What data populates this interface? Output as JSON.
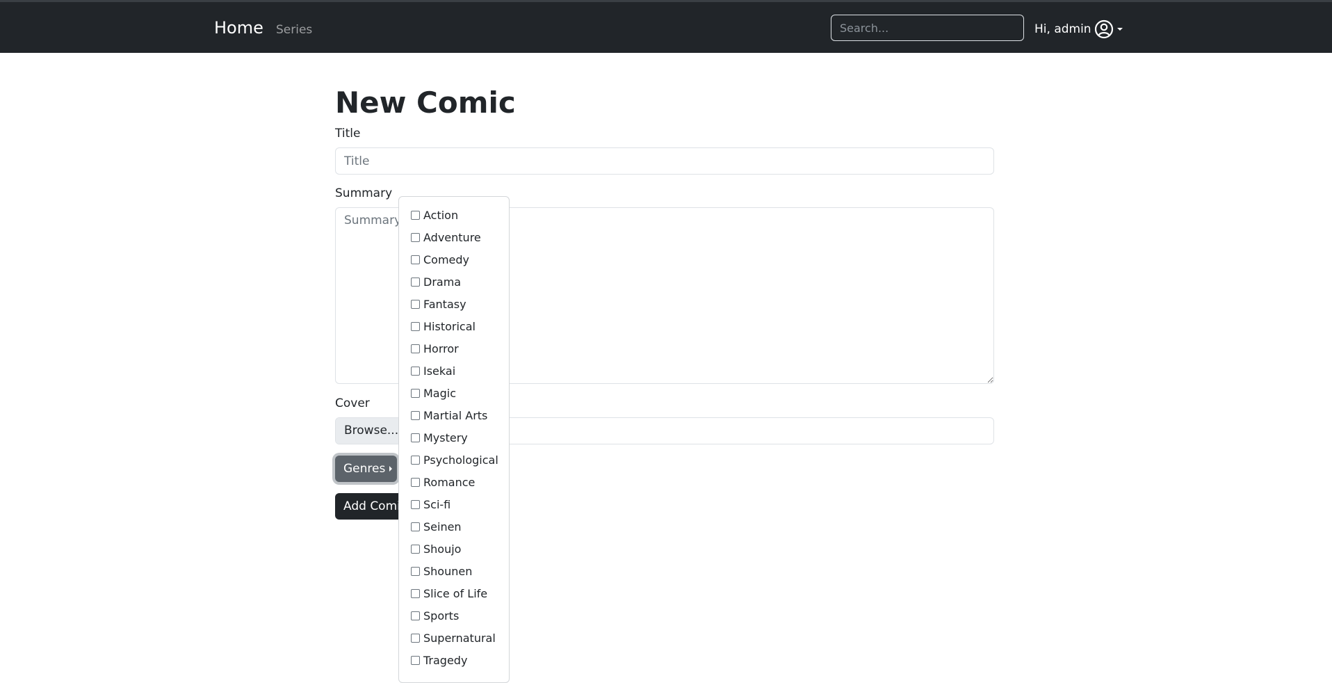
{
  "navbar": {
    "brand": "Home",
    "links": [
      "Series"
    ],
    "search_placeholder": "Search...",
    "user_greeting": "Hi, admin"
  },
  "form": {
    "heading": "New Comic",
    "title_label": "Title",
    "title_placeholder": "Title",
    "summary_label": "Summary",
    "summary_placeholder": "Summary",
    "cover_label": "Cover",
    "browse_label": "Browse...",
    "genres_button": "Genres",
    "submit_button": "Add Comic"
  },
  "genres": [
    {
      "label": "Action",
      "checked": false
    },
    {
      "label": "Adventure",
      "checked": false
    },
    {
      "label": "Comedy",
      "checked": false
    },
    {
      "label": "Drama",
      "checked": false
    },
    {
      "label": "Fantasy",
      "checked": false
    },
    {
      "label": "Historical",
      "checked": false
    },
    {
      "label": "Horror",
      "checked": false
    },
    {
      "label": "Isekai",
      "checked": false
    },
    {
      "label": "Magic",
      "checked": false
    },
    {
      "label": "Martial Arts",
      "checked": false
    },
    {
      "label": "Mystery",
      "checked": false
    },
    {
      "label": "Psychological",
      "checked": false
    },
    {
      "label": "Romance",
      "checked": false
    },
    {
      "label": "Sci-fi",
      "checked": false
    },
    {
      "label": "Seinen",
      "checked": false
    },
    {
      "label": "Shoujo",
      "checked": false
    },
    {
      "label": "Shounen",
      "checked": false
    },
    {
      "label": "Slice of Life",
      "checked": false
    },
    {
      "label": "Sports",
      "checked": false
    },
    {
      "label": "Supernatural",
      "checked": false
    },
    {
      "label": "Tragedy",
      "checked": false
    }
  ],
  "colors": {
    "navbar_bg": "#212529",
    "secondary_btn": "#5c636a",
    "dark_btn": "#212529"
  }
}
